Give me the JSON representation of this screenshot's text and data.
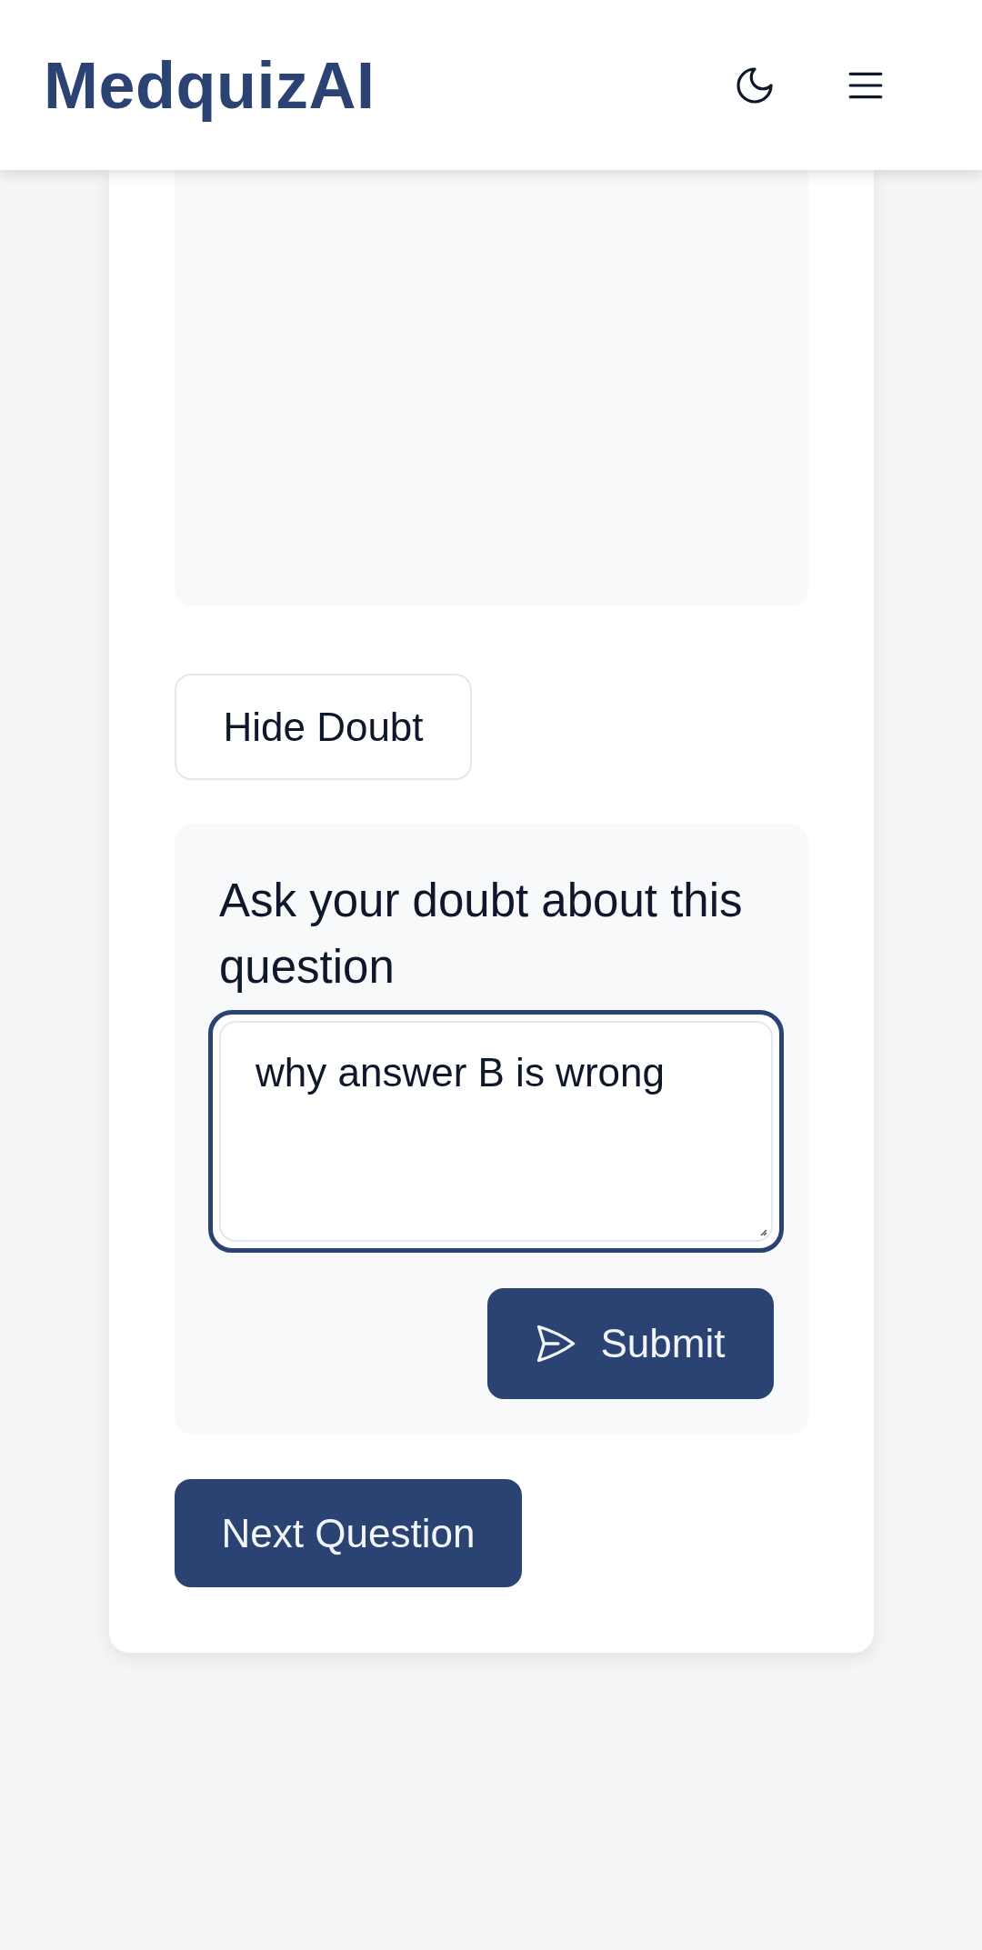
{
  "header": {
    "logo": "MedquizAI"
  },
  "doubt_toggle": {
    "label": "Hide Doubt"
  },
  "doubt_panel": {
    "heading": "Ask your doubt about this question",
    "input": {
      "value": "why answer B is wrong",
      "focused": true
    },
    "submit": {
      "label": "Submit"
    }
  },
  "next_button": {
    "label": "Next Question"
  }
}
